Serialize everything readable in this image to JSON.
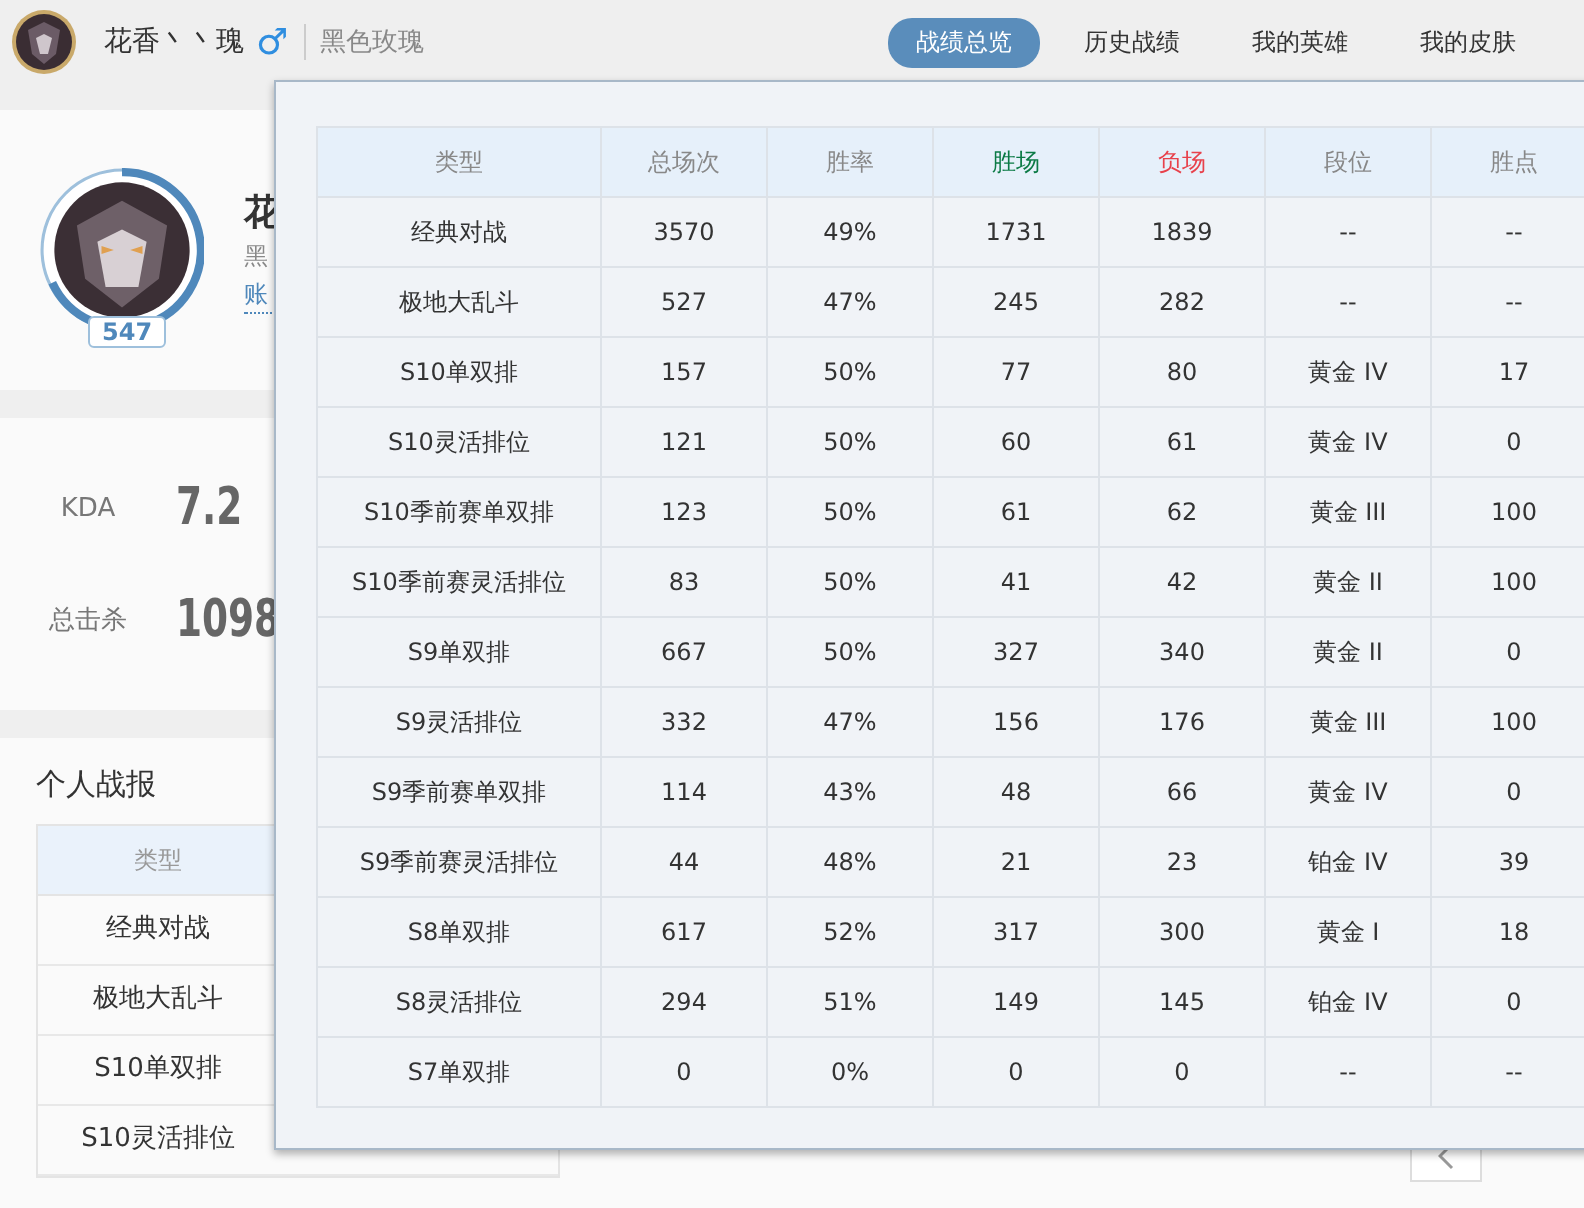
{
  "header": {
    "name": "花香丶丶瑰",
    "gender_icon": "♂",
    "server": "黑色玫瑰"
  },
  "tabs": [
    {
      "label": "战绩总览",
      "selected": true
    },
    {
      "label": "历史战绩",
      "selected": false
    },
    {
      "label": "我的英雄",
      "selected": false
    },
    {
      "label": "我的皮肤",
      "selected": false
    }
  ],
  "profile": {
    "name": "花",
    "server": "黑",
    "account": "账",
    "level": "547"
  },
  "stats": [
    {
      "label": "KDA",
      "value": "7.2"
    },
    {
      "label": "总击杀",
      "value": "1098"
    }
  ],
  "report": {
    "title": "个人战报",
    "column": "类型",
    "rows": [
      "经典对战",
      "极地大乱斗",
      "S10单双排",
      "S10灵活排位"
    ]
  },
  "popup": {
    "columns": [
      {
        "label": "类型"
      },
      {
        "label": "总场次"
      },
      {
        "label": "胜率"
      },
      {
        "label": "胜场",
        "color": "#0b7a45"
      },
      {
        "label": "负场",
        "color": "#e8414b"
      },
      {
        "label": "段位"
      },
      {
        "label": "胜点"
      }
    ],
    "rows": [
      [
        "经典对战",
        "3570",
        "49%",
        "1731",
        "1839",
        "--",
        "--"
      ],
      [
        "极地大乱斗",
        "527",
        "47%",
        "245",
        "282",
        "--",
        "--"
      ],
      [
        "S10单双排",
        "157",
        "50%",
        "77",
        "80",
        "黄金 IV",
        "17"
      ],
      [
        "S10灵活排位",
        "121",
        "50%",
        "60",
        "61",
        "黄金 IV",
        "0"
      ],
      [
        "S10季前赛单双排",
        "123",
        "50%",
        "61",
        "62",
        "黄金 III",
        "100"
      ],
      [
        "S10季前赛灵活排位",
        "83",
        "50%",
        "41",
        "42",
        "黄金 II",
        "100"
      ],
      [
        "S9单双排",
        "667",
        "50%",
        "327",
        "340",
        "黄金 II",
        "0"
      ],
      [
        "S9灵活排位",
        "332",
        "47%",
        "156",
        "176",
        "黄金 III",
        "100"
      ],
      [
        "S9季前赛单双排",
        "114",
        "43%",
        "48",
        "66",
        "黄金 IV",
        "0"
      ],
      [
        "S9季前赛灵活排位",
        "44",
        "48%",
        "21",
        "23",
        "铂金 IV",
        "39"
      ],
      [
        "S8单双排",
        "617",
        "52%",
        "317",
        "300",
        "黄金 I",
        "18"
      ],
      [
        "S8灵活排位",
        "294",
        "51%",
        "149",
        "145",
        "铂金 IV",
        "0"
      ],
      [
        "S7单双排",
        "0",
        "0%",
        "0",
        "0",
        "--",
        "--"
      ]
    ]
  }
}
